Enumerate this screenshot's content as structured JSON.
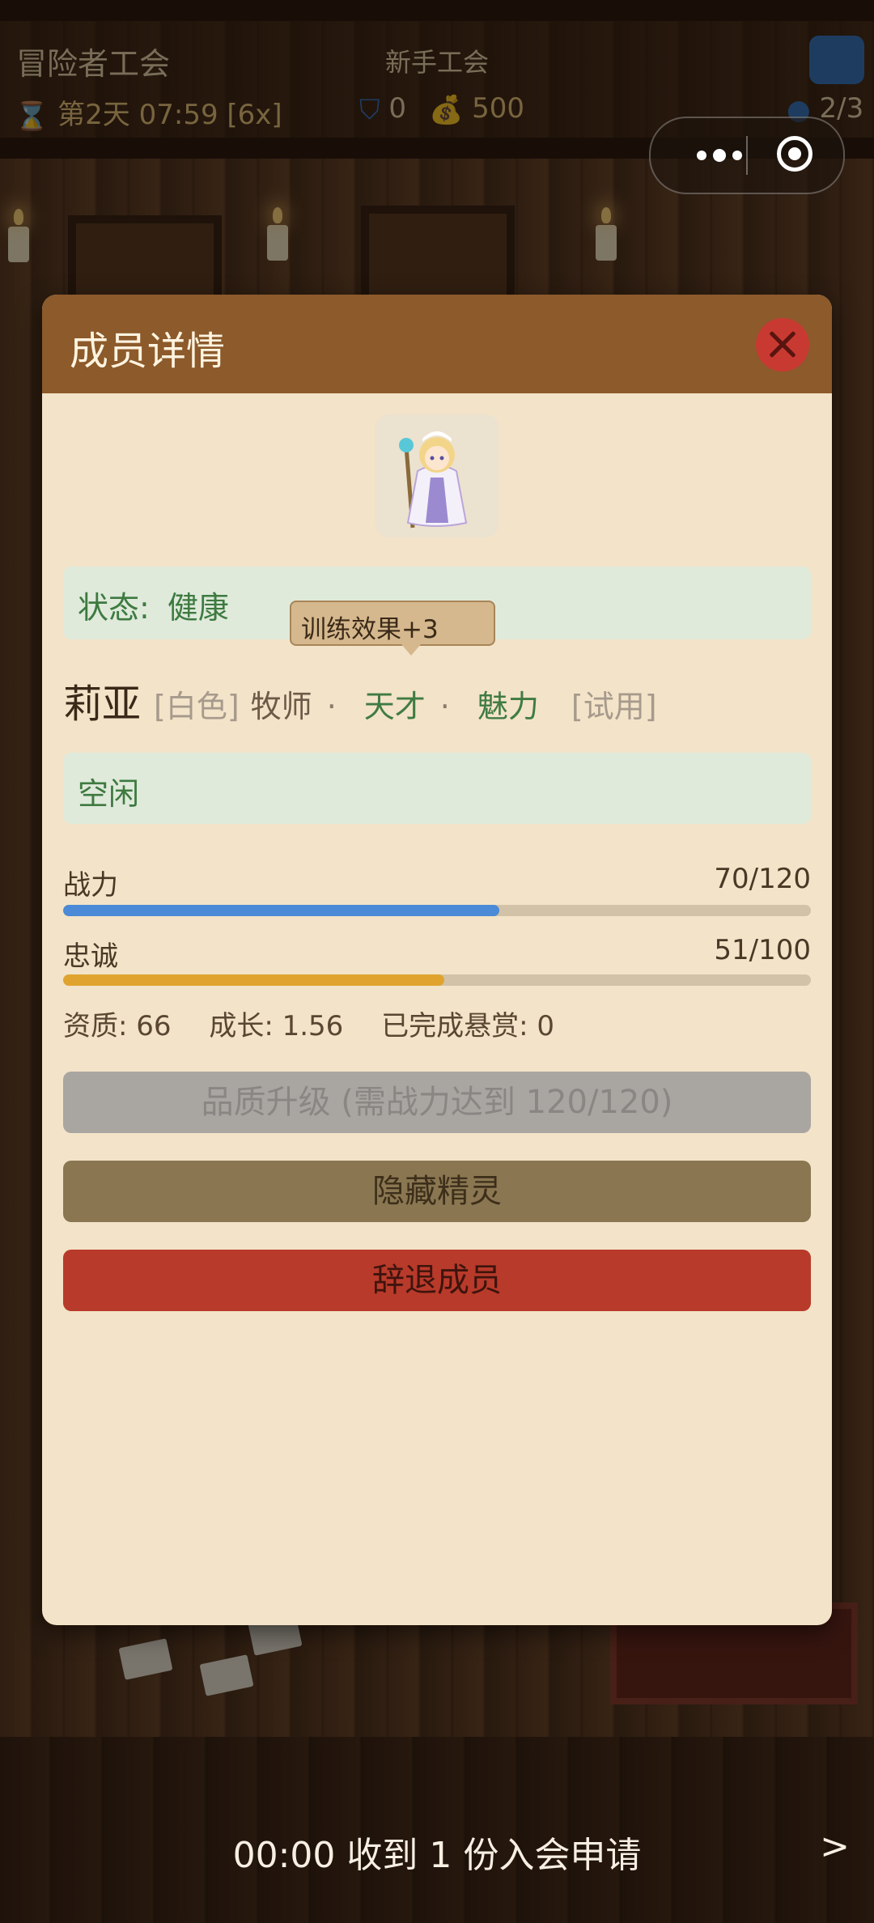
{
  "hud": {
    "title": "冒险者工会",
    "guild_rank": "新手工会",
    "day_time": "第2天 07:59 [6x]",
    "defense": "0",
    "gold": "500",
    "members": "2/3"
  },
  "modal": {
    "title": "成员详情",
    "status_label": "状态:",
    "status_value": "健康",
    "tooltip": "训练效果+3",
    "member": {
      "name": "莉亚",
      "rarity": "[白色]",
      "class": "牧师",
      "traits": [
        "天才",
        "魅力"
      ],
      "trial": "[试用]"
    },
    "activity": "空闲",
    "stats": {
      "power": {
        "label": "战力",
        "current": 70,
        "max": 120,
        "display": "70/120",
        "color": "#4a8ad6"
      },
      "loyalty": {
        "label": "忠诚",
        "current": 51,
        "max": 100,
        "display": "51/100",
        "color": "#e0a42e"
      }
    },
    "attributes": {
      "aptitude": "资质: 66",
      "growth": "成长: 1.56",
      "bounties": "已完成悬赏: 0"
    },
    "buttons": {
      "upgrade": "品质升级 (需战力达到 120/120)",
      "hide": "隐藏精灵",
      "dismiss": "辞退成员"
    }
  },
  "notification": {
    "text": "00:00 收到 1 份入会申请",
    "arrow": ">"
  }
}
